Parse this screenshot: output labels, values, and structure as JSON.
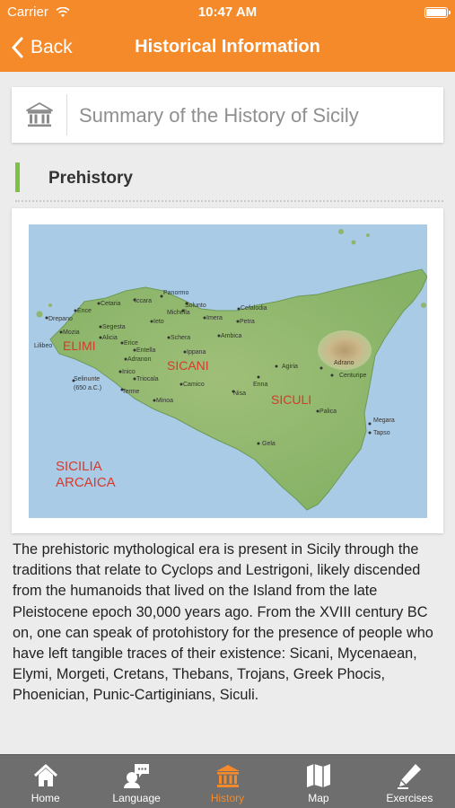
{
  "status_bar": {
    "carrier": "Carrier",
    "time": "10:47 AM"
  },
  "nav": {
    "back_label": "Back",
    "title": "Historical Information"
  },
  "summary": {
    "title": "Summary of the History of Sicily",
    "icon": "museum-icon"
  },
  "section": {
    "title": "Prehistory"
  },
  "map": {
    "regions": [
      "ELIMI",
      "SICANI",
      "SICULI",
      "SICILIA",
      "ARCAICA"
    ],
    "places": [
      "Panormo",
      "Solunto",
      "Cetaria",
      "Iccara",
      "Cefalodia",
      "Michella",
      "Imera",
      "Ence",
      "Drepano",
      "Ieto",
      "Petra",
      "Segesta",
      "Mozia",
      "Alicia",
      "Schera",
      "Ambica",
      "Lilibeo",
      "Entella",
      "Erice",
      "Ippana",
      "Adranon",
      "Agiria",
      "Adrano",
      "Inico",
      "Triocala",
      "Selinunte",
      "(650 a.C.)",
      "Camico",
      "Enna",
      "Centuripe",
      "Terme",
      "Nisa",
      "Minoa",
      "Palica",
      "Megara",
      "Tapso",
      "Gela"
    ],
    "colors": {
      "sea": "#a9cbe6",
      "land": "#a7c583",
      "mountain": "#c7b487",
      "label": "#d63a2b"
    }
  },
  "paragraph": "The prehistoric mythological era is present in Sicily through the traditions that relate to Cyclops and Lestrigoni, likely discended from the humanoids that lived on the Island from the late Pleistocene epoch 30,000 years ago. From the XVIII century BC on, one can speak of protohistory for the presence of people who have left tangible traces of their existence: Sicani, Mycenaean, Elymi, Morgeti, Cretans, Thebans, Trojans, Greek Phocis, Phoenician, Punic-Cartiginians, Siculi.",
  "tabs": [
    {
      "label": "Home",
      "icon": "home-icon",
      "active": false
    },
    {
      "label": "Language",
      "icon": "language-icon",
      "active": false
    },
    {
      "label": "History",
      "icon": "history-icon",
      "active": true
    },
    {
      "label": "Map",
      "icon": "map-icon",
      "active": false
    },
    {
      "label": "Exercises",
      "icon": "exercises-icon",
      "active": false
    }
  ],
  "colors": {
    "accent": "#f58a2a",
    "section_bar": "#7dc242",
    "tab_bar": "#6e6e6e"
  }
}
